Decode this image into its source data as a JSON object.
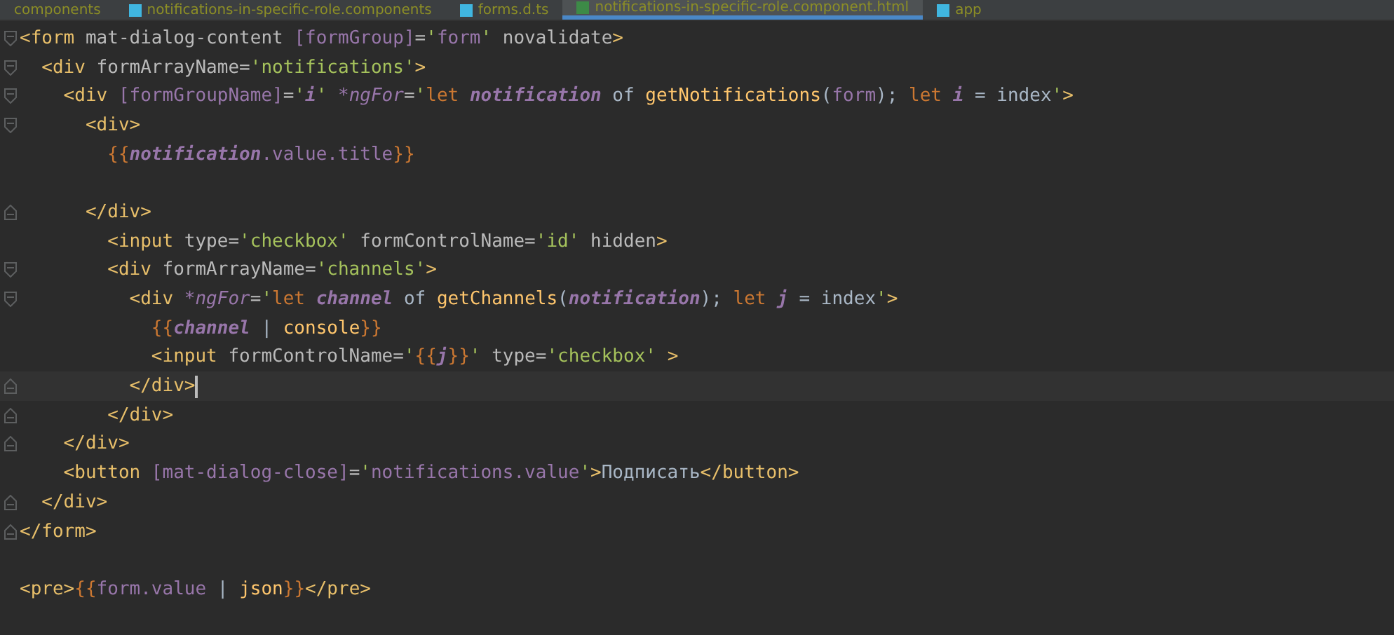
{
  "tabs": [
    {
      "label": "components",
      "selected": false,
      "icon": false
    },
    {
      "label": "notifications-in-specific-role.components",
      "selected": false,
      "icon": true
    },
    {
      "label": "forms.d.ts",
      "selected": false,
      "icon": true
    },
    {
      "label": "notifications-in-specific-role.component.html",
      "selected": true,
      "icon": true
    },
    {
      "label": "app",
      "selected": false,
      "icon": true
    }
  ],
  "editor": {
    "lines": [
      {
        "fold_start": true,
        "current": false,
        "tokens": [
          {
            "kind": "tag",
            "text": "<form"
          },
          {
            "kind": "attr",
            "text": " mat-dialog-content "
          },
          {
            "kind": "bind",
            "text": "[formGroup]"
          },
          {
            "kind": "attr",
            "text": "="
          },
          {
            "kind": "str",
            "text": "'"
          },
          {
            "kind": "bind",
            "text": "form"
          },
          {
            "kind": "str",
            "text": "'"
          },
          {
            "kind": "attr",
            "text": " novalidate"
          },
          {
            "kind": "tag",
            "text": ">"
          }
        ]
      },
      {
        "fold_start": true,
        "current": false,
        "tokens": [
          {
            "kind": "tag",
            "text": "  <div"
          },
          {
            "kind": "attr",
            "text": " formArrayName="
          },
          {
            "kind": "str",
            "text": "'notifications'"
          },
          {
            "kind": "tag",
            "text": ">"
          }
        ]
      },
      {
        "fold_start": true,
        "current": false,
        "tokens": [
          {
            "kind": "tag",
            "text": "    <div "
          },
          {
            "kind": "bind",
            "text": "[formGroupName]"
          },
          {
            "kind": "attr",
            "text": "="
          },
          {
            "kind": "str",
            "text": "'"
          },
          {
            "kind": "var",
            "text": "i"
          },
          {
            "kind": "str",
            "text": "' "
          },
          {
            "kind": "ng",
            "text": "*ngFor"
          },
          {
            "kind": "attr",
            "text": "="
          },
          {
            "kind": "str",
            "text": "'"
          },
          {
            "kind": "kw",
            "text": "let "
          },
          {
            "kind": "var",
            "text": "notification"
          },
          {
            "kind": "plain",
            "text": " of "
          },
          {
            "kind": "fn",
            "text": "getNotifications"
          },
          {
            "kind": "plain",
            "text": "("
          },
          {
            "kind": "bind",
            "text": "form"
          },
          {
            "kind": "plain",
            "text": "); "
          },
          {
            "kind": "kw",
            "text": "let "
          },
          {
            "kind": "var",
            "text": "i"
          },
          {
            "kind": "plain",
            "text": " = index"
          },
          {
            "kind": "str",
            "text": "'"
          },
          {
            "kind": "tag",
            "text": ">"
          }
        ]
      },
      {
        "fold_start": true,
        "current": false,
        "tokens": [
          {
            "kind": "tag",
            "text": "      <div>"
          }
        ]
      },
      {
        "current": false,
        "tokens": [
          {
            "kind": "brace",
            "text": "        {{"
          },
          {
            "kind": "var",
            "text": "notification"
          },
          {
            "kind": "bind",
            "text": ".value.title"
          },
          {
            "kind": "brace",
            "text": "}}"
          }
        ]
      },
      {
        "current": false
      },
      {
        "fold_end": true,
        "current": false,
        "tokens": [
          {
            "kind": "tag",
            "text": "      </div>"
          }
        ]
      },
      {
        "current": false,
        "tokens": [
          {
            "kind": "tag",
            "text": "        <input"
          },
          {
            "kind": "attr",
            "text": " type="
          },
          {
            "kind": "str",
            "text": "'checkbox'"
          },
          {
            "kind": "attr",
            "text": " formControlName="
          },
          {
            "kind": "str",
            "text": "'id'"
          },
          {
            "kind": "attr",
            "text": " hidden"
          },
          {
            "kind": "tag",
            "text": ">"
          }
        ]
      },
      {
        "fold_start": true,
        "current": false,
        "tokens": [
          {
            "kind": "tag",
            "text": "        <div"
          },
          {
            "kind": "attr",
            "text": " formArrayName="
          },
          {
            "kind": "str",
            "text": "'channels'"
          },
          {
            "kind": "tag",
            "text": ">"
          }
        ]
      },
      {
        "fold_start": true,
        "current": false,
        "tokens": [
          {
            "kind": "tag",
            "text": "          <div "
          },
          {
            "kind": "ng",
            "text": "*ngFor"
          },
          {
            "kind": "attr",
            "text": "="
          },
          {
            "kind": "str",
            "text": "'"
          },
          {
            "kind": "kw",
            "text": "let "
          },
          {
            "kind": "var",
            "text": "channel"
          },
          {
            "kind": "plain",
            "text": " of "
          },
          {
            "kind": "fn",
            "text": "getChannels"
          },
          {
            "kind": "plain",
            "text": "("
          },
          {
            "kind": "var",
            "text": "notification"
          },
          {
            "kind": "plain",
            "text": "); "
          },
          {
            "kind": "kw",
            "text": "let "
          },
          {
            "kind": "var",
            "text": "j"
          },
          {
            "kind": "plain",
            "text": " = index"
          },
          {
            "kind": "str",
            "text": "'"
          },
          {
            "kind": "tag",
            "text": ">"
          }
        ]
      },
      {
        "current": false,
        "tokens": [
          {
            "kind": "brace",
            "text": "            {{"
          },
          {
            "kind": "var",
            "text": "channel"
          },
          {
            "kind": "plain",
            "text": " | "
          },
          {
            "kind": "fn",
            "text": "console"
          },
          {
            "kind": "brace",
            "text": "}}"
          }
        ]
      },
      {
        "current": false,
        "tokens": [
          {
            "kind": "tag",
            "text": "            <input"
          },
          {
            "kind": "attr",
            "text": " formControlName="
          },
          {
            "kind": "str",
            "text": "'"
          },
          {
            "kind": "brace",
            "text": "{{"
          },
          {
            "kind": "var",
            "text": "j"
          },
          {
            "kind": "brace",
            "text": "}}"
          },
          {
            "kind": "str",
            "text": "'"
          },
          {
            "kind": "attr",
            "text": " type="
          },
          {
            "kind": "str",
            "text": "'checkbox'"
          },
          {
            "kind": "tag",
            "text": " >"
          }
        ]
      },
      {
        "fold_end": true,
        "current": true,
        "tokens": [
          {
            "kind": "tag",
            "text": "          </div>"
          }
        ]
      },
      {
        "fold_end": true,
        "current": false,
        "tokens": [
          {
            "kind": "tag",
            "text": "        </div>"
          }
        ]
      },
      {
        "fold_end": true,
        "current": false,
        "tokens": [
          {
            "kind": "tag",
            "text": "    </div>"
          }
        ]
      },
      {
        "current": false,
        "tokens": [
          {
            "kind": "tag",
            "text": "    <button "
          },
          {
            "kind": "bind",
            "text": "[mat-dialog-close]"
          },
          {
            "kind": "attr",
            "text": "="
          },
          {
            "kind": "str",
            "text": "'"
          },
          {
            "kind": "bind",
            "text": "notifications.value"
          },
          {
            "kind": "str",
            "text": "'"
          },
          {
            "kind": "tag",
            "text": ">"
          },
          {
            "kind": "plain",
            "text": "Подписать"
          },
          {
            "kind": "tag",
            "text": "</button>"
          }
        ]
      },
      {
        "fold_end": true,
        "current": false,
        "tokens": [
          {
            "kind": "tag",
            "text": "  </div>"
          }
        ]
      },
      {
        "fold_end": true,
        "current": false,
        "tokens": [
          {
            "kind": "tag",
            "text": "</form>"
          }
        ]
      },
      {
        "current": false
      },
      {
        "current": false,
        "tokens": [
          {
            "kind": "tag",
            "text": "<pre>"
          },
          {
            "kind": "brace",
            "text": "{{"
          },
          {
            "kind": "bind",
            "text": "form.value"
          },
          {
            "kind": "plain",
            "text": " | "
          },
          {
            "kind": "fn",
            "text": "json"
          },
          {
            "kind": "brace",
            "text": "}}"
          },
          {
            "kind": "tag",
            "text": "</pre>"
          }
        ]
      }
    ]
  }
}
